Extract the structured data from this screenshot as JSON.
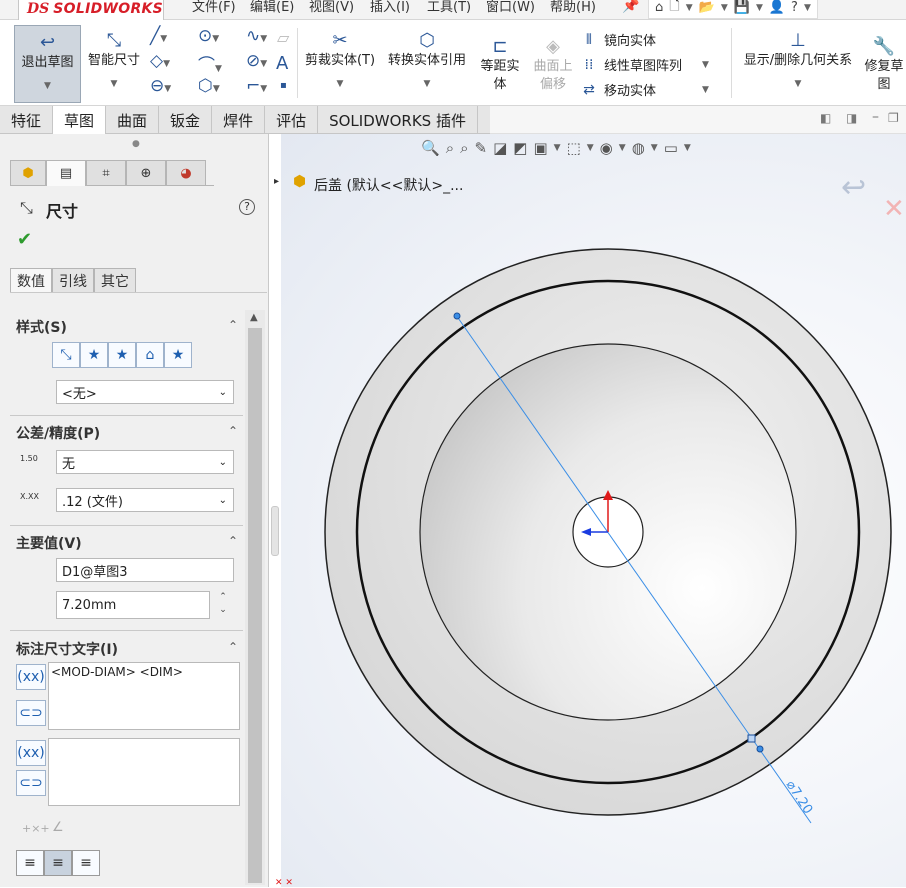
{
  "app": {
    "logo_ds": "DS",
    "logo_name": "SOLIDWORKS"
  },
  "menu": [
    "文件(F)",
    "编辑(E)",
    "视图(V)",
    "插入(I)",
    "工具(T)",
    "窗口(W)",
    "帮助(H)"
  ],
  "ribbon": {
    "exit_sketch": "退出草图",
    "smart_dim": "智能尺寸",
    "trim": "剪裁实体(T)",
    "convert": "转换实体引用",
    "offset_line1": "等距实",
    "offset_line2": "体",
    "surface_offset_line1": "曲面上",
    "surface_offset_line2": "偏移",
    "mirror": "镜向实体",
    "linear_pattern": "线性草图阵列",
    "move": "移动实体",
    "show_relations": "显示/删除几何关系",
    "repair_line1": "修复草",
    "repair_line2": "图"
  },
  "tabs": [
    "特征",
    "草图",
    "曲面",
    "钣金",
    "焊件",
    "评估",
    "SOLIDWORKS 插件"
  ],
  "panel": {
    "title": "尺寸",
    "subtabs": [
      "数值",
      "引线",
      "其它"
    ],
    "style": {
      "title": "样式(S)",
      "select": "<无>"
    },
    "tolerance": {
      "title": "公差/精度(P)",
      "tol_select": "无",
      "prec_select": ".12 (文件)",
      "tol_icon_text": "1.50",
      "prec_icon_text": "X.XX"
    },
    "primary": {
      "title": "主要值(V)",
      "name": "D1@草图3",
      "value": "7.20mm"
    },
    "dimtext": {
      "title": "标注尺寸文字(I)",
      "text": "<MOD-DIAM> <DIM>"
    }
  },
  "graphics": {
    "tree_label": "后盖  (默认<<默认>_...",
    "dimension_label": "⌀7.20"
  },
  "colors": {
    "accent": "#2b5797",
    "brand": "#d71e28",
    "dim_line": "#3a8ee6"
  }
}
